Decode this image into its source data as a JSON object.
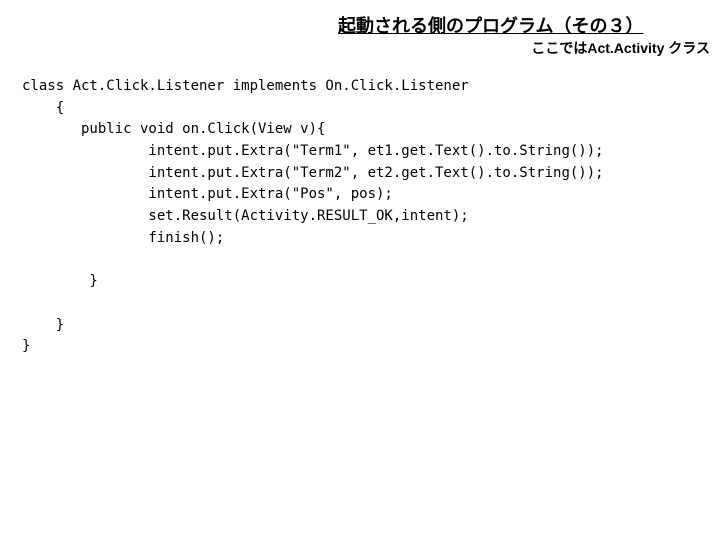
{
  "title": "起動される側のプログラム（その３）",
  "subtitle": "ここではAct.Activity クラス",
  "code": {
    "line1": "class Act.Click.Listener implements On.Click.Listener",
    "line2": "    {",
    "line3": "       public void on.Click(View v){",
    "line4": "               intent.put.Extra(\"Term1\", et1.get.Text().to.String());",
    "line5": "               intent.put.Extra(\"Term2\", et2.get.Text().to.String());",
    "line6": "               intent.put.Extra(\"Pos\", pos);",
    "line7": "               set.Result(Activity.RESULT_OK,intent);",
    "line8": "               finish();",
    "line9": "",
    "line10": "        }",
    "line11": "",
    "line12": "    }",
    "line13": "}"
  }
}
